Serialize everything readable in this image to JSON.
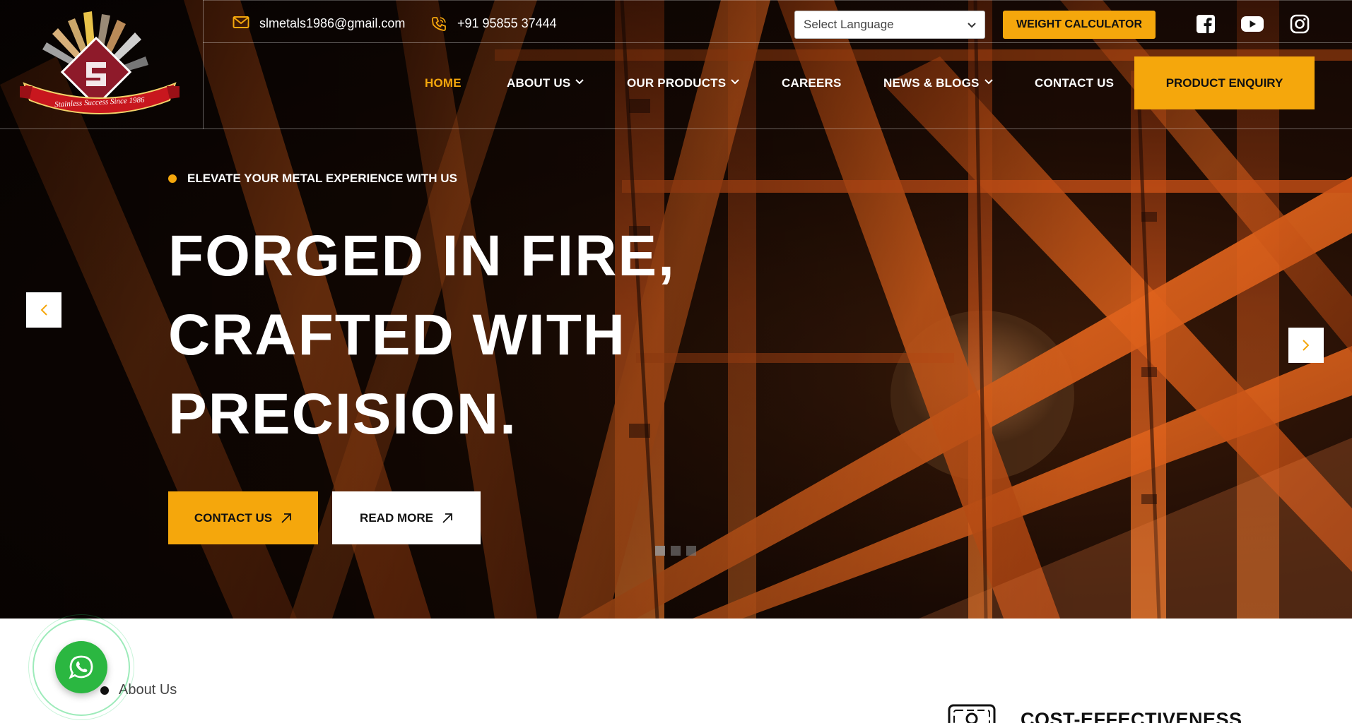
{
  "header": {
    "logo_tagline": "Stainless Success Since 1986",
    "email": "slmetals1986@gmail.com",
    "phone": "+91 95855 37444",
    "language_select": "Select Language",
    "weight_calculator": "WEIGHT CALCULATOR",
    "social": [
      "facebook-icon",
      "youtube-icon",
      "instagram-icon"
    ],
    "nav": {
      "home": "HOME",
      "about": "ABOUT US",
      "products": "OUR PRODUCTS",
      "careers": "CAREERS",
      "news": "NEWS & BLOGS",
      "contact": "CONTACT US"
    },
    "enquiry": "PRODUCT ENQUIRY"
  },
  "hero": {
    "tagline": "ELEVATE YOUR METAL EXPERIENCE WITH US",
    "headline": [
      "FORGED IN FIRE,",
      "CRAFTED WITH",
      "PRECISION."
    ],
    "contact_button": "CONTACT US",
    "read_more_button": "READ MORE",
    "slide_count": 3,
    "active_slide": 1
  },
  "about": {
    "label": "About Us",
    "feature_title": "COST-EFFECTIVENESS"
  },
  "colors": {
    "accent": "#f5a70c",
    "whatsapp": "#2bb741",
    "steel": "#d9581a"
  }
}
